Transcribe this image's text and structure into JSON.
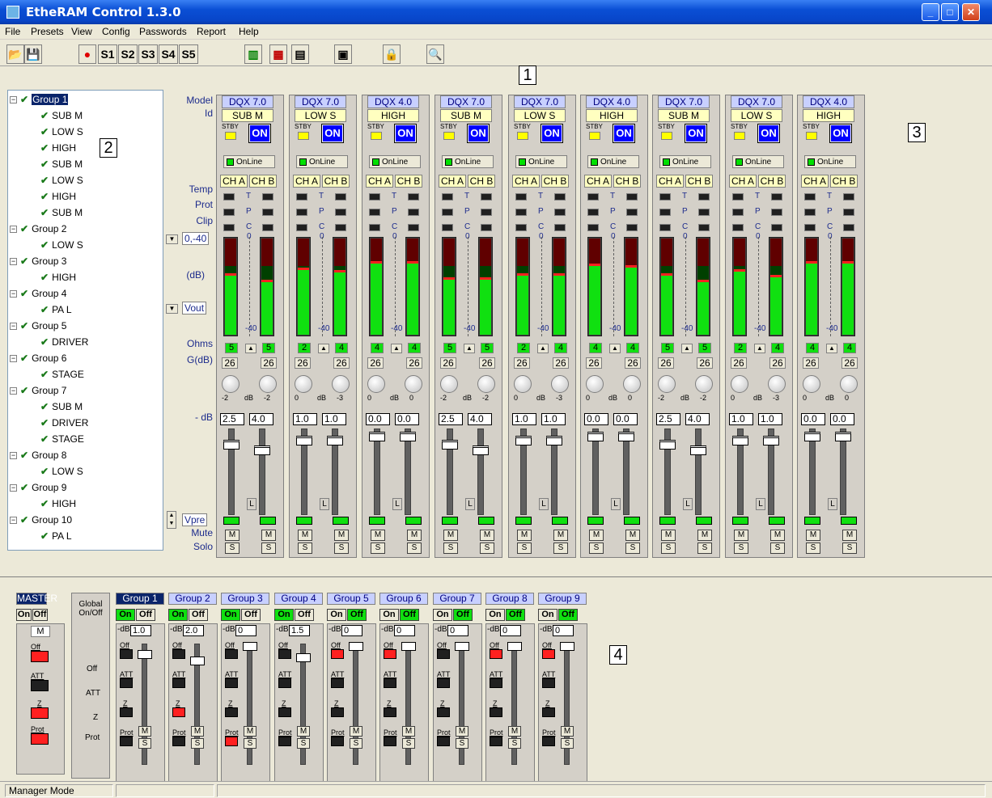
{
  "window": {
    "title": "EtheRAM Control  1.3.0"
  },
  "menu": [
    "File",
    "Presets",
    "View",
    "Config",
    "Passwords",
    "Report",
    "Help"
  ],
  "toolbar": {
    "snapshots": [
      "S1",
      "S2",
      "S3",
      "S4",
      "S5"
    ]
  },
  "callouts": [
    "1",
    "2",
    "3",
    "4"
  ],
  "tree": {
    "groups": [
      {
        "name": "Group 1",
        "items": [
          "SUB M",
          "LOW S",
          "HIGH",
          "SUB M",
          "LOW S",
          "HIGH",
          "SUB M"
        ]
      },
      {
        "name": "Group 2",
        "items": [
          "LOW S"
        ]
      },
      {
        "name": "Group 3",
        "items": [
          "HIGH"
        ]
      },
      {
        "name": "Group 4",
        "items": [
          "PA L"
        ]
      },
      {
        "name": "Group 5",
        "items": [
          "DRIVER"
        ]
      },
      {
        "name": "Group 6",
        "items": [
          "STAGE"
        ]
      },
      {
        "name": "Group 7",
        "items": [
          "SUB M",
          "DRIVER",
          "STAGE"
        ]
      },
      {
        "name": "Group 8",
        "items": [
          "LOW S"
        ]
      },
      {
        "name": "Group 9",
        "items": [
          "HIGH"
        ]
      },
      {
        "name": "Group 10",
        "items": [
          "PA L"
        ]
      }
    ]
  },
  "row_labels": {
    "model": "Model",
    "id": "Id",
    "temp": "Temp",
    "prot": "Prot",
    "clip": "Clip",
    "range": "0,-40",
    "db": "(dB)",
    "vout": "Vout",
    "ohms": "Ohms",
    "gdb": "G(dB)",
    "minusdb": "- dB",
    "vpre": "Vpre",
    "mute": "Mute",
    "solo": "Solo"
  },
  "strip_labels": {
    "stby": "STBY",
    "on": "ON",
    "online": "OnLine",
    "cha": "CH A",
    "chb": "CH B",
    "t": "T",
    "p": "P",
    "c": "C",
    "zero": "0",
    "minus40": "-40",
    "db": "dB",
    "l": "L",
    "m": "M",
    "s": "S"
  },
  "channels": [
    {
      "model": "DQX 7.0",
      "id": "SUB M",
      "ohms": [
        "5",
        "5"
      ],
      "gain": [
        "26",
        "26"
      ],
      "knob": [
        "-2",
        "-2"
      ],
      "db": [
        "2.5",
        "4.0"
      ],
      "meter": [
        0.62,
        0.55
      ],
      "fader": [
        0.1,
        0.17
      ]
    },
    {
      "model": "DQX 7.0",
      "id": "LOW S",
      "ohms": [
        "2",
        "4"
      ],
      "gain": [
        "26",
        "26"
      ],
      "knob": [
        "0",
        "-3"
      ],
      "db": [
        "1.0",
        "1.0"
      ],
      "meter": [
        0.68,
        0.65
      ],
      "fader": [
        0.05,
        0.05
      ]
    },
    {
      "model": "DQX 4.0",
      "id": "HIGH",
      "ohms": [
        "4",
        "4"
      ],
      "gain": [
        "26",
        "26"
      ],
      "knob": [
        "0",
        "0"
      ],
      "db": [
        "0.0",
        "0.0"
      ],
      "meter": [
        0.74,
        0.74
      ],
      "fader": [
        0.0,
        0.0
      ]
    },
    {
      "model": "DQX 7.0",
      "id": "SUB M",
      "ohms": [
        "5",
        "5"
      ],
      "gain": [
        "26",
        "26"
      ],
      "knob": [
        "-2",
        "-2"
      ],
      "db": [
        "2.5",
        "4.0"
      ],
      "meter": [
        0.58,
        0.58
      ],
      "fader": [
        0.1,
        0.17
      ]
    },
    {
      "model": "DQX 7.0",
      "id": "LOW S",
      "ohms": [
        "2",
        "4"
      ],
      "gain": [
        "26",
        "26"
      ],
      "knob": [
        "0",
        "-3"
      ],
      "db": [
        "1.0",
        "1.0"
      ],
      "meter": [
        0.62,
        0.62
      ],
      "fader": [
        0.05,
        0.05
      ]
    },
    {
      "model": "DQX 4.0",
      "id": "HIGH",
      "ohms": [
        "4",
        "4"
      ],
      "gain": [
        "26",
        "26"
      ],
      "knob": [
        "0",
        "0"
      ],
      "db": [
        "0.0",
        "0.0"
      ],
      "meter": [
        0.72,
        0.7
      ],
      "fader": [
        0.0,
        0.0
      ]
    },
    {
      "model": "DQX 7.0",
      "id": "SUB M",
      "ohms": [
        "5",
        "5"
      ],
      "gain": [
        "26",
        "26"
      ],
      "knob": [
        "-2",
        "-2"
      ],
      "db": [
        "2.5",
        "4.0"
      ],
      "meter": [
        0.62,
        0.55
      ],
      "fader": [
        0.1,
        0.17
      ]
    },
    {
      "model": "DQX 7.0",
      "id": "LOW S",
      "ohms": [
        "2",
        "4"
      ],
      "gain": [
        "26",
        "26"
      ],
      "knob": [
        "0",
        "-3"
      ],
      "db": [
        "1.0",
        "1.0"
      ],
      "meter": [
        0.66,
        0.6
      ],
      "fader": [
        0.05,
        0.05
      ]
    },
    {
      "model": "DQX 4.0",
      "id": "HIGH",
      "ohms": [
        "4",
        "4"
      ],
      "gain": [
        "26",
        "26"
      ],
      "knob": [
        "0",
        "0"
      ],
      "db": [
        "0.0",
        "0.0"
      ],
      "meter": [
        0.74,
        0.74
      ],
      "fader": [
        0.0,
        0.0
      ]
    }
  ],
  "master": {
    "label": "MASTER",
    "on": "On",
    "off": "Off",
    "m": "M",
    "off_lbl": "Off",
    "att": "ATT",
    "z": "Z",
    "prot": "Prot"
  },
  "global_labels": {
    "title": "Global On/Off",
    "off": "Off",
    "att": "ATT",
    "z": "Z",
    "prot": "Prot"
  },
  "group_labels": {
    "on": "On",
    "off": "Off",
    "db": "-dB",
    "off_small": "Off",
    "att": "ATT",
    "z": "Z",
    "prot": "Prot",
    "m": "M",
    "s": "S"
  },
  "groups": [
    {
      "name": "Group 1",
      "db": "1.0",
      "on": true,
      "off_red": false,
      "z_red": false,
      "prot_red": false,
      "fader": 0.07
    },
    {
      "name": "Group 2",
      "db": "2.0",
      "on": true,
      "off_red": false,
      "z_red": true,
      "prot_red": false,
      "fader": 0.13
    },
    {
      "name": "Group 3",
      "db": "0",
      "on": true,
      "off_red": false,
      "z_red": false,
      "prot_red": true,
      "fader": 0.0
    },
    {
      "name": "Group 4",
      "db": "1.5",
      "on": true,
      "off_red": false,
      "z_red": false,
      "prot_red": false,
      "fader": 0.1
    },
    {
      "name": "Group 5",
      "db": "0",
      "on": false,
      "off_red": true,
      "z_red": false,
      "prot_red": false,
      "fader": 0.0
    },
    {
      "name": "Group 6",
      "db": "0",
      "on": false,
      "off_red": true,
      "z_red": false,
      "prot_red": false,
      "fader": 0.0
    },
    {
      "name": "Group 7",
      "db": "0",
      "on": false,
      "off_red": false,
      "z_red": false,
      "prot_red": false,
      "fader": 0.0
    },
    {
      "name": "Group 8",
      "db": "0",
      "on": false,
      "off_red": true,
      "z_red": false,
      "prot_red": false,
      "fader": 0.0
    },
    {
      "name": "Group 9",
      "db": "0",
      "on": false,
      "off_red": true,
      "z_red": false,
      "prot_red": false,
      "fader": 0.0
    }
  ],
  "status": {
    "mode": "Manager Mode"
  }
}
